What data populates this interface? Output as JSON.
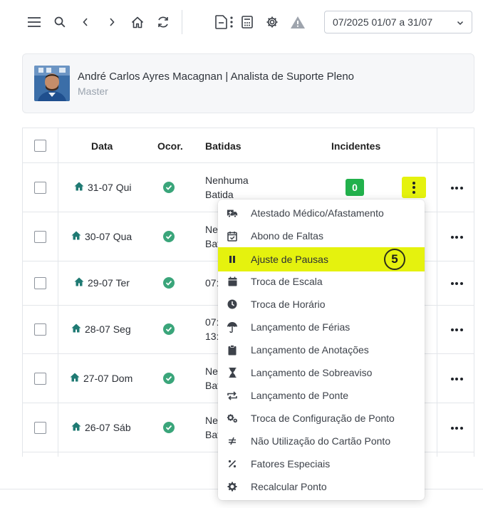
{
  "toolbar": {
    "icons": [
      "menu-icon",
      "search-icon",
      "chevron-left-icon",
      "chevron-right-icon",
      "home-icon",
      "refresh-icon",
      "document-options-icon",
      "calculator-icon",
      "gear-icon",
      "warning-icon"
    ],
    "period_label": "07/2025  01/07 a 31/07"
  },
  "user": {
    "name": "André Carlos Ayres Macagnan | Analista de Suporte Pleno",
    "role": "Master"
  },
  "table": {
    "headers": {
      "data": "Data",
      "ocor": "Ocor.",
      "batidas": "Batidas",
      "incidentes": "Incidentes"
    },
    "rows": [
      {
        "date": "31-07 Qui",
        "batidas": [
          "Nenhuma",
          "Batida"
        ],
        "incidentes": "0"
      },
      {
        "date": "30-07 Qua",
        "batidas": [
          "Nenhuma",
          "Batida"
        ]
      },
      {
        "date": "29-07 Ter",
        "batidas": [
          "07:"
        ]
      },
      {
        "date": "28-07 Seg",
        "batidas": [
          "07:",
          "13:"
        ]
      },
      {
        "date": "27-07 Dom",
        "batidas": [
          "Nenhuma",
          "Batida"
        ]
      },
      {
        "date": "26-07 Sáb",
        "batidas": [
          "Nenhuma",
          "Batida"
        ]
      }
    ]
  },
  "menu": {
    "items": [
      {
        "label": "Atestado Médico/Afastamento",
        "icon": "ambulance-icon"
      },
      {
        "label": "Abono de Faltas",
        "icon": "calendar-check-icon"
      },
      {
        "label": "Ajuste de Pausas",
        "icon": "pause-icon"
      },
      {
        "label": "Troca de Escala",
        "icon": "calendar-icon"
      },
      {
        "label": "Troca de Horário",
        "icon": "clock-icon"
      },
      {
        "label": "Lançamento de Férias",
        "icon": "umbrella-icon"
      },
      {
        "label": "Lançamento de Anotações",
        "icon": "clipboard-icon"
      },
      {
        "label": "Lançamento de Sobreaviso",
        "icon": "hourglass-icon"
      },
      {
        "label": "Lançamento de Ponte",
        "icon": "repeat-icon"
      },
      {
        "label": "Troca de Configuração de Ponto",
        "icon": "gears-icon"
      },
      {
        "label": "Não Utilização do Cartão Ponto",
        "icon": "not-equal-icon"
      },
      {
        "label": "Fatores Especiais",
        "icon": "percent-icon"
      },
      {
        "label": "Recalcular Ponto",
        "icon": "gear-icon"
      }
    ],
    "highlighted_index": 2,
    "step_badge": "5"
  },
  "colors": {
    "highlight": "#e5f20e",
    "incident_badge": "#22b14c",
    "status_ok": "#3aa57a",
    "home_icon": "#1f7a73"
  }
}
